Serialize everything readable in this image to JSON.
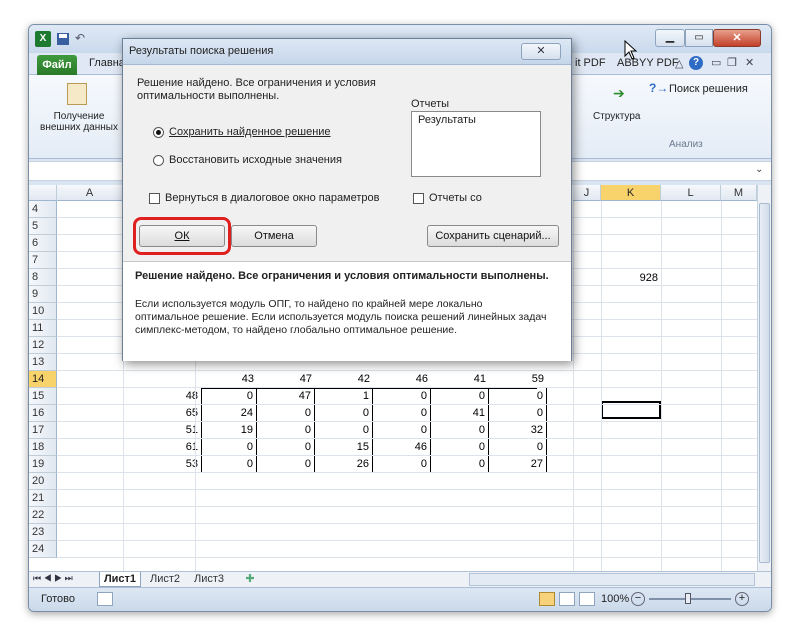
{
  "window": {
    "file_tab": "Файл",
    "home_tab": "Главна",
    "right_tabs": [
      "it PDF",
      "ABBYY PDF"
    ],
    "ribbon": {
      "get_data_label_1": "Получение",
      "get_data_label_2": "внешних данных",
      "structure_label": "Структура",
      "solver_label": "Поиск решения",
      "analysis_group": "Анализ"
    }
  },
  "grid": {
    "left_columns": [
      "A"
    ],
    "right_columns": [
      "J",
      "K",
      "L",
      "M"
    ],
    "rows": [
      "4",
      "5",
      "6",
      "7",
      "8",
      "9",
      "10",
      "11",
      "12",
      "13",
      "14",
      "15",
      "16",
      "17",
      "18",
      "19",
      "20",
      "21",
      "22",
      "23",
      "24"
    ],
    "active_row": "14",
    "k6_value": "928",
    "header_row": [
      "43",
      "47",
      "42",
      "46",
      "41",
      "59"
    ],
    "table_rows": [
      {
        "first": "48",
        "values": [
          "0",
          "47",
          "1",
          "0",
          "0",
          "0"
        ]
      },
      {
        "first": "65",
        "values": [
          "24",
          "0",
          "0",
          "0",
          "41",
          "0"
        ]
      },
      {
        "first": "51",
        "values": [
          "19",
          "0",
          "0",
          "0",
          "0",
          "32"
        ]
      },
      {
        "first": "61",
        "values": [
          "0",
          "0",
          "15",
          "46",
          "0",
          "0"
        ]
      },
      {
        "first": "53",
        "values": [
          "0",
          "0",
          "26",
          "0",
          "0",
          "27"
        ]
      }
    ]
  },
  "sheets": {
    "nav": "⏮ ◀ ▶ ⏭",
    "tabs": [
      "Лист1",
      "Лист2",
      "Лист3"
    ],
    "active": "Лист1"
  },
  "status": {
    "ready": "Готово",
    "zoom": "100%"
  },
  "dialog": {
    "title": "Результаты поиска решения",
    "message_line1": "Решение найдено. Все ограничения и условия",
    "message_line2": "оптимальности выполнены.",
    "keep_solution": "Сохранить найденное решение",
    "restore_values": "Восстановить исходные значения",
    "reports_label": "Отчеты",
    "reports_item": "Результаты",
    "return_params": "Вернуться в диалоговое окно параметров",
    "outline_reports": "Отчеты со",
    "ok": "ОК",
    "cancel": "Отмена",
    "save_scenario": "Сохранить сценарий...",
    "summary_bold": "Решение найдено. Все ограничения и условия оптимальности выполнены.",
    "detail_line1": "Если используется модуль ОПГ, то найдено по крайней мере локально",
    "detail_line2": "оптимальное решение. Если используется модуль поиска решений линейных задач",
    "detail_line3": "симплекс-методом, то найдено глобально оптимальное решение."
  },
  "colors": {
    "highlight": "#e02020",
    "file_tab": "#2e7d2e",
    "active_header": "#f8d36b"
  }
}
